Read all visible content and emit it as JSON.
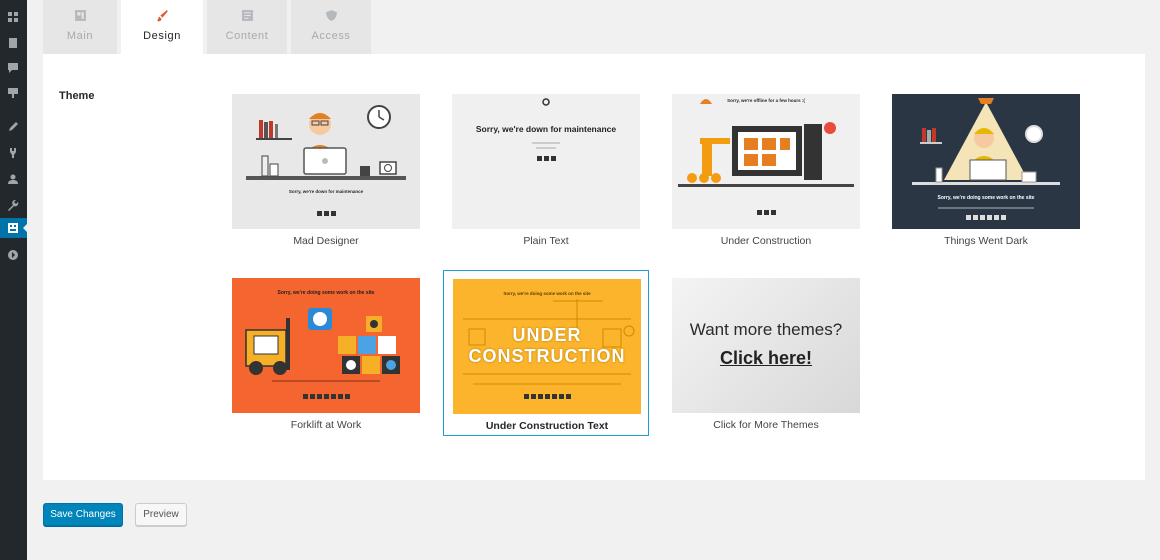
{
  "tabs": [
    {
      "label": "Main",
      "icon": "layout-icon"
    },
    {
      "label": "Design",
      "icon": "paintbrush-icon"
    },
    {
      "label": "Content",
      "icon": "document-icon"
    },
    {
      "label": "Access",
      "icon": "shield-icon"
    }
  ],
  "active_tab": "Design",
  "theme_section": {
    "label": "Theme"
  },
  "themes": [
    {
      "name": "Mad Designer",
      "thumb_text": "Sorry, we're down for maintenance"
    },
    {
      "name": "Plain Text",
      "thumb_text": "Sorry, we're down for maintenance"
    },
    {
      "name": "Under Construction",
      "thumb_text": "Sorry, we're offline for a few hours :("
    },
    {
      "name": "Things Went Dark",
      "thumb_text": "Sorry, we're doing some work on the site"
    },
    {
      "name": "Forklift at Work",
      "thumb_text": "Sorry, we're doing some work on the site"
    },
    {
      "name": "Under Construction Text",
      "thumb_text": "Sorry, we're doing some work on the site",
      "thumb_big": "UNDER CONSTRUCTION"
    },
    {
      "name": "Click for More Themes",
      "thumb_line1": "Want more themes?",
      "thumb_line2": "Click here!"
    }
  ],
  "selected_theme": "Under Construction Text",
  "buttons": {
    "save": "Save Changes",
    "preview": "Preview"
  },
  "colors": {
    "accent": "#0085ba",
    "selected_border": "#1e9fd1",
    "sidebar": "#23282d"
  }
}
